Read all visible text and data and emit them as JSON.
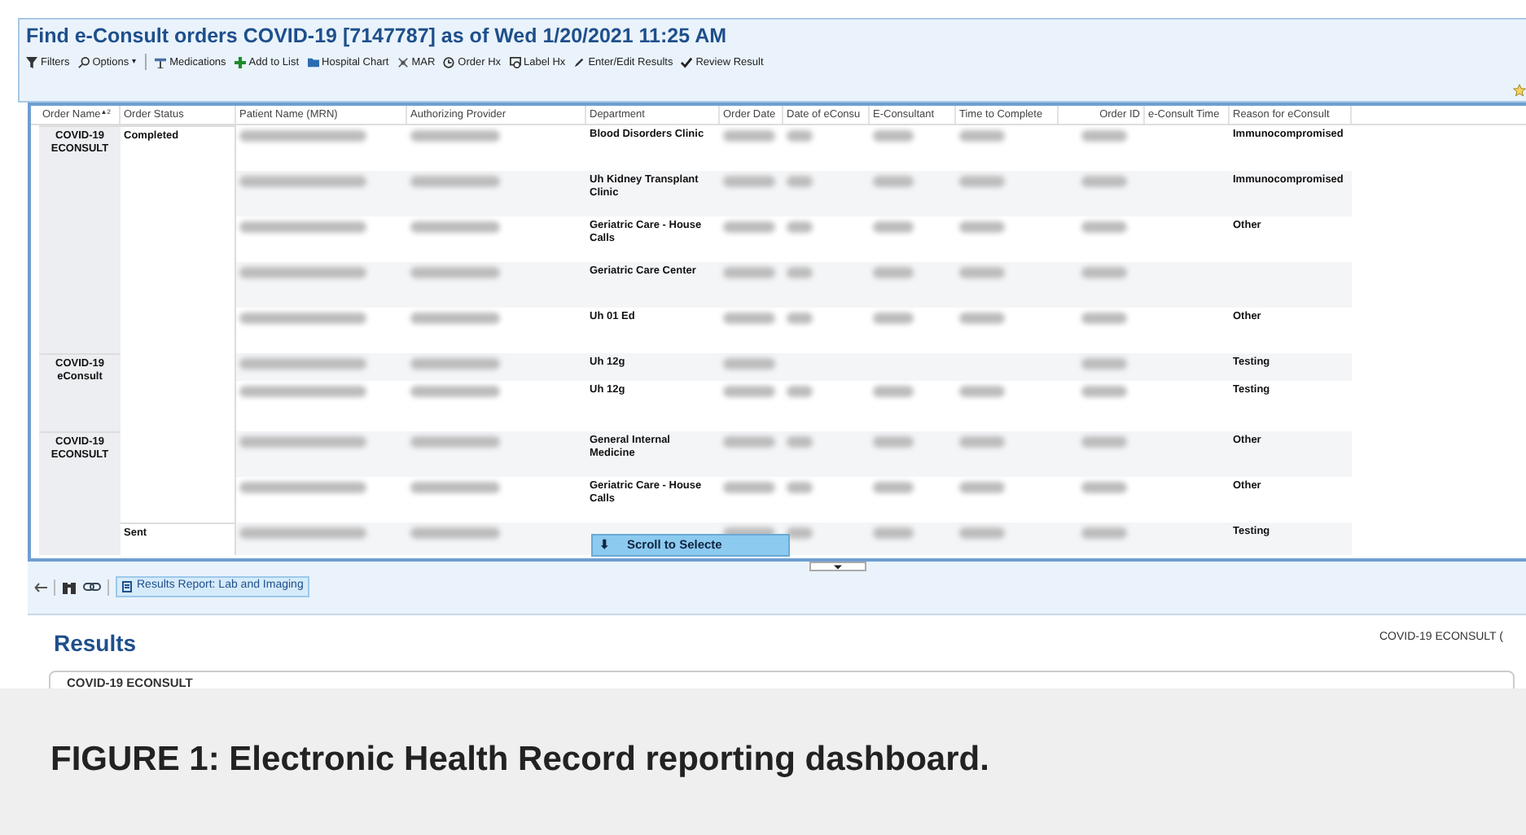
{
  "window": {
    "title": "Find e-Consult orders COVID-19 [7147787] as of Wed 1/20/2021 11:25 AM"
  },
  "toolbar": [
    {
      "label": "Filters"
    },
    {
      "label": "Options",
      "caret": "▾"
    },
    {
      "label": "Medications"
    },
    {
      "label": "Add to List"
    },
    {
      "label": "Hospital Chart"
    },
    {
      "label": "MAR"
    },
    {
      "label": "Order Hx"
    },
    {
      "label": "Label Hx"
    },
    {
      "label": "Enter/Edit Results"
    },
    {
      "label": "Review Result"
    }
  ],
  "table": {
    "columns": [
      "Order Name",
      "Order Status",
      "Patient Name (MRN)",
      "Authorizing Provider",
      "Department",
      "Order Date",
      "Date of eConsu",
      "E-Consultant",
      "Time to Complete",
      "Order ID",
      "e-Consult Time",
      "Reason for eConsult"
    ],
    "sort_mark": "▲2",
    "rows": [
      {
        "order_name": "COVID-19 ECONSULT",
        "status": "Completed",
        "department": "Blood Disorders Clinic",
        "reason": "Immunocompromised"
      },
      {
        "department": "Uh Kidney Transplant Clinic",
        "reason": "Immunocompromised"
      },
      {
        "department": "Geriatric Care - House Calls",
        "reason": "Other"
      },
      {
        "department": "Geriatric Care Center"
      },
      {
        "department": "Uh 01 Ed",
        "reason": "Other"
      },
      {
        "order_name": "COVID-19 eConsult",
        "department": "Uh 12g",
        "reason": "Testing"
      },
      {
        "department": "Uh 12g",
        "reason": "Testing"
      },
      {
        "order_name": "COVID-19 ECONSULT",
        "department": "General Internal Medicine",
        "reason": "Other"
      },
      {
        "department": "Geriatric Care - House Calls",
        "reason": "Other"
      },
      {
        "status": "Sent",
        "reason": "Testing"
      }
    ]
  },
  "scroll_button": {
    "icon": "⬇",
    "label": "Scroll to Selecte"
  },
  "bottom_toolbar": {
    "tab": "Results Report: Lab and Imaging"
  },
  "results": {
    "title": "Results",
    "right_label": "COVID-19 ECONSULT (",
    "card_title": "COVID-19 ECONSULT"
  },
  "caption": "FIGURE 1: Electronic Health Record reporting dashboard."
}
